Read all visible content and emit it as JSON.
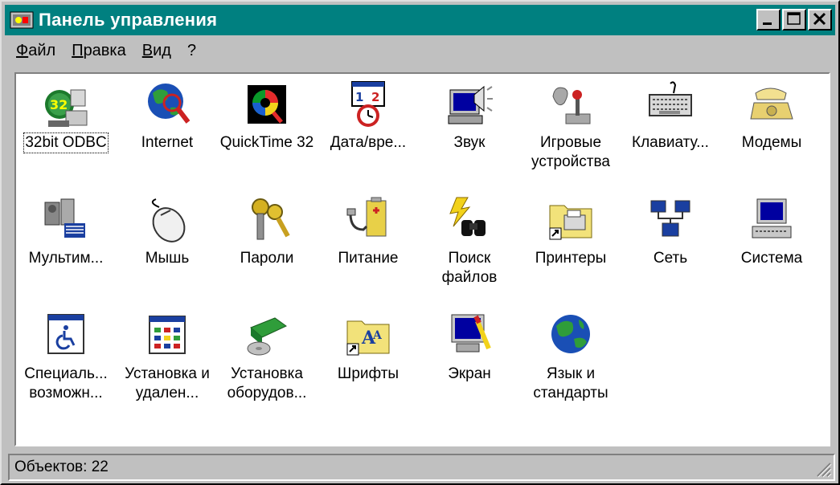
{
  "window": {
    "title": "Панель управления"
  },
  "menu": [
    "Файл",
    "Правка",
    "Вид",
    "?"
  ],
  "items": [
    {
      "label": "32bit ODBC",
      "icon": "odbc-icon"
    },
    {
      "label": "Internet",
      "icon": "internet-globe-icon"
    },
    {
      "label": "QuickTime 32",
      "icon": "quicktime-icon"
    },
    {
      "label": "Дата/вре...",
      "icon": "date-time-icon"
    },
    {
      "label": "Звук",
      "icon": "sound-icon"
    },
    {
      "label": "Игровые устройства",
      "icon": "joystick-icon"
    },
    {
      "label": "Клавиату...",
      "icon": "keyboard-icon"
    },
    {
      "label": "Модемы",
      "icon": "modem-icon"
    },
    {
      "label": "Мультим...",
      "icon": "multimedia-icon"
    },
    {
      "label": "Мышь",
      "icon": "mouse-icon"
    },
    {
      "label": "Пароли",
      "icon": "keys-icon"
    },
    {
      "label": "Питание",
      "icon": "power-icon"
    },
    {
      "label": "Поиск файлов",
      "icon": "find-files-icon"
    },
    {
      "label": "Принтеры",
      "icon": "printers-folder-icon"
    },
    {
      "label": "Сеть",
      "icon": "network-icon"
    },
    {
      "label": "Система",
      "icon": "system-computer-icon"
    },
    {
      "label": "Специаль... возможн...",
      "icon": "accessibility-icon"
    },
    {
      "label": "Установка и удален...",
      "icon": "add-remove-programs-icon"
    },
    {
      "label": "Установка оборудов...",
      "icon": "add-hardware-icon"
    },
    {
      "label": "Шрифты",
      "icon": "fonts-folder-icon"
    },
    {
      "label": "Экран",
      "icon": "display-icon"
    },
    {
      "label": "Язык и стандарты",
      "icon": "regional-settings-globe-icon"
    }
  ],
  "status": {
    "text": "Объектов: 22"
  },
  "colors": {
    "titlebar": "#008080",
    "face": "#c0c0c0",
    "content": "#ffffff"
  }
}
